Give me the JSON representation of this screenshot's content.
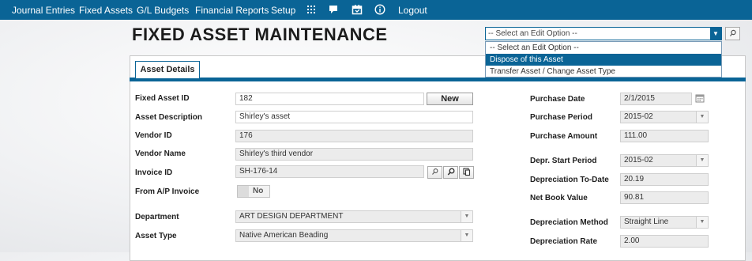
{
  "nav": {
    "items": [
      "Journal Entries",
      "Fixed Assets",
      "G/L Budgets",
      "Financial Reports",
      "Setup"
    ],
    "logout": "Logout",
    "icons": [
      "grid-icon",
      "chat-icon",
      "calendar-icon",
      "info-icon"
    ]
  },
  "page": {
    "title": "FIXED ASSET MAINTENANCE"
  },
  "edit_option": {
    "selected": "-- Select an Edit Option --",
    "options": [
      "-- Select an Edit Option --",
      "Dispose of this Asset",
      "Transfer Asset / Change Asset Type"
    ],
    "highlighted_index": 1
  },
  "tabs": {
    "active": "Asset Details"
  },
  "left": {
    "asset_id_label": "Fixed Asset ID",
    "asset_id": "182",
    "new_button": "New",
    "desc_label": "Asset Description",
    "desc": "Shirley's asset",
    "vendor_id_label": "Vendor ID",
    "vendor_id": "176",
    "vendor_name_label": "Vendor Name",
    "vendor_name": "Shirley's third vendor",
    "invoice_id_label": "Invoice ID",
    "invoice_id": "SH-176-14",
    "from_ap_label": "From A/P Invoice",
    "from_ap_value": "No",
    "department_label": "Department",
    "department": "ART DESIGN DEPARTMENT",
    "asset_type_label": "Asset Type",
    "asset_type": "Native American Beading"
  },
  "right": {
    "purchase_date_label": "Purchase Date",
    "purchase_date": "2/1/2015",
    "purchase_period_label": "Purchase Period",
    "purchase_period": "2015-02",
    "purchase_amount_label": "Purchase Amount",
    "purchase_amount": "111.00",
    "depr_start_label": "Depr. Start Period",
    "depr_start": "2015-02",
    "depr_todate_label": "Depreciation To-Date",
    "depr_todate": "20.19",
    "nbv_label": "Net Book Value",
    "nbv": "90.81",
    "depr_method_label": "Depreciation Method",
    "depr_method": "Straight Line",
    "depr_rate_label": "Depreciation Rate",
    "depr_rate": "2.00"
  },
  "colors": {
    "brand": "#0a6496",
    "readonly_bg": "#ececec"
  }
}
